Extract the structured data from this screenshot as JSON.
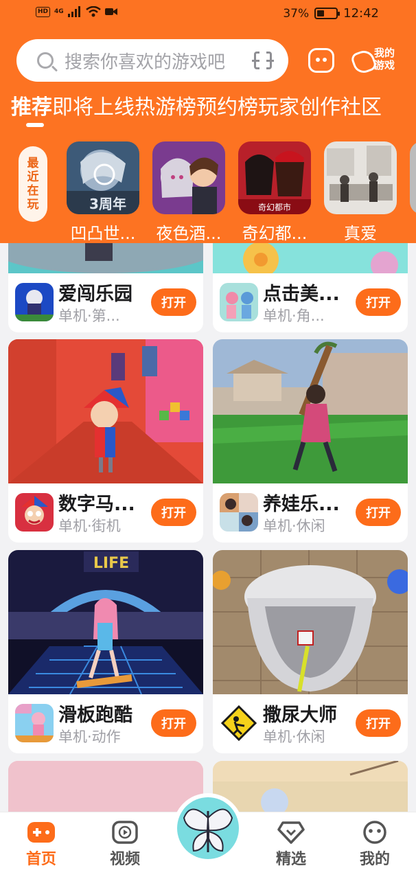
{
  "status_bar": {
    "network": "4G",
    "battery_percent": "37%",
    "battery_level": 0.37,
    "time": "12:42"
  },
  "search": {
    "placeholder": "搜索你喜欢的游戏吧"
  },
  "header": {
    "my_games_label": "我的游戏"
  },
  "tabs": [
    {
      "label": "推荐",
      "active": true
    },
    {
      "label": "即将上线",
      "active": false
    },
    {
      "label": "热游榜",
      "active": false
    },
    {
      "label": "预约榜",
      "active": false
    },
    {
      "label": "玩家创作",
      "active": false
    },
    {
      "label": "社区",
      "active": false
    }
  ],
  "recent": {
    "label": "最近在玩",
    "items": [
      {
        "name": "凹凸世...",
        "badge": "3周年"
      },
      {
        "name": "夜色酒..."
      },
      {
        "name": "奇幻都...",
        "badge": "奇幻都市"
      },
      {
        "name": "真爱"
      },
      {
        "name": "空"
      }
    ]
  },
  "cards": [
    {
      "title": "爱闯乐园",
      "tags": "单机·第...",
      "button": "打开"
    },
    {
      "title": "点击美...",
      "tags": "单机·角...",
      "button": "打开"
    },
    {
      "title": "数字马...",
      "tags": "单机·街机",
      "button": "打开"
    },
    {
      "title": "养娃乐...",
      "tags": "单机·休闲",
      "button": "打开"
    },
    {
      "title": "滑板跑酷",
      "tags": "单机·动作",
      "button": "打开",
      "image_sign": "LIFE"
    },
    {
      "title": "撒尿大师",
      "tags": "单机·休闲",
      "button": "打开"
    }
  ],
  "bottom_nav": [
    {
      "label": "首页",
      "icon": "gamepad-icon",
      "active": true
    },
    {
      "label": "视频",
      "icon": "play-icon",
      "active": false
    },
    {
      "label": "",
      "icon": "butterfly-icon",
      "active": false
    },
    {
      "label": "精选",
      "icon": "heart-diamond-icon",
      "active": false
    },
    {
      "label": "我的",
      "icon": "face-icon",
      "active": false
    }
  ],
  "colors": {
    "brand_orange": "#fd7322",
    "button_orange": "#fd6c1a",
    "background": "#f2f2f4"
  }
}
